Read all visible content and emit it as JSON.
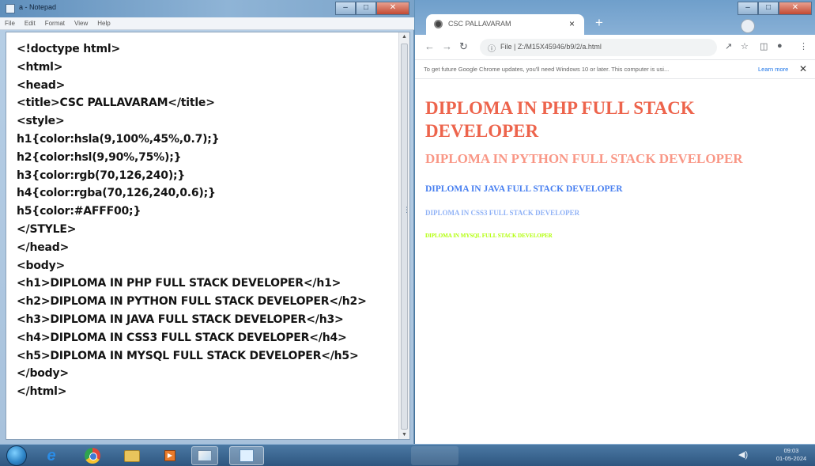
{
  "notepad": {
    "title": "a - Notepad",
    "menu": [
      "File",
      "Edit",
      "Format",
      "View",
      "Help"
    ],
    "lines": [
      "<!doctype html>",
      "<html>",
      "<head>",
      "<title>CSC PALLAVARAM</title>",
      "<style>",
      "h1{color:hsla(9,100%,45%,0.7);}",
      "h2{color:hsl(9,90%,75%);}",
      "h3{color:rgb(70,126,240);}",
      "h4{color:rgba(70,126,240,0.6);}",
      "h5{color:#AFFF00;}",
      "</STYLE>",
      "</head>",
      "<body>",
      "<h1>DIPLOMA IN PHP FULL STACK DEVELOPER</h1>",
      "<h2>DIPLOMA IN PYTHON FULL STACK DEVELOPER</h2>",
      "<h3>DIPLOMA IN JAVA FULL STACK DEVELOPER</h3>",
      "<h4>DIPLOMA IN CSS3 FULL STACK DEVELOPER</h4>",
      "<h5>DIPLOMA IN MYSQL FULL STACK DEVELOPER</h5>",
      "</body>",
      "</html>"
    ]
  },
  "browser": {
    "tab_title": "CSC PALLAVARAM",
    "url": "File | Z:/M15X45946/b9/2/a.html",
    "infobar_text": "To get future Google Chrome updates, you'll need Windows 10 or later. This computer is usi...",
    "infobar_link": "Learn more",
    "headings": [
      {
        "text": "DIPLOMA IN PHP FULL STACK DEVELOPER",
        "color": "hsla(9,100%,45%,0.7)"
      },
      {
        "text": "DIPLOMA IN PYTHON FULL STACK DEVELOPER",
        "color": "hsl(9,90%,75%)"
      },
      {
        "text": "DIPLOMA IN JAVA FULL STACK DEVELOPER",
        "color": "rgb(70,126,240)"
      },
      {
        "text": "DIPLOMA IN CSS3 FULL STACK DEVELOPER",
        "color": "rgba(70,126,240,0.6)"
      },
      {
        "text": "DIPLOMA IN MYSQL FULL STACK DEVELOPER",
        "color": "#AFFF00"
      }
    ]
  },
  "taskbar": {
    "clock_time": "09:03",
    "clock_date": "01-05-2024"
  }
}
